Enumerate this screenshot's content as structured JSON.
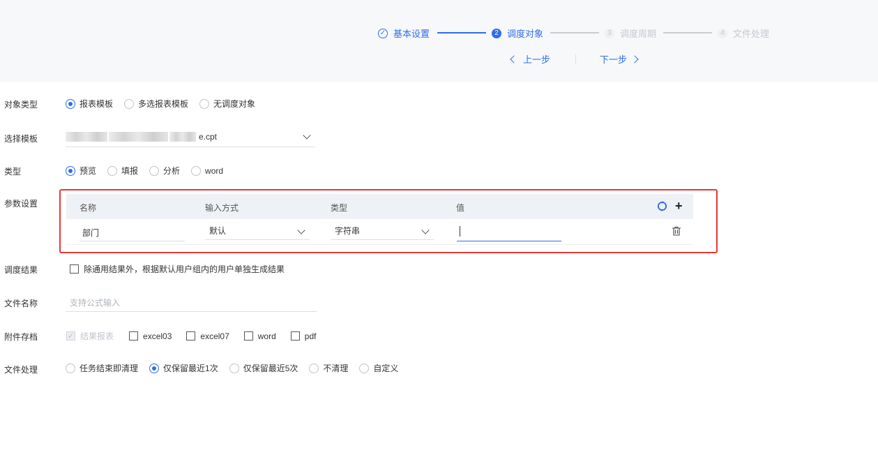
{
  "steps": [
    {
      "num": "✓",
      "label": "基本设置",
      "state": "done"
    },
    {
      "num": "2",
      "label": "调度对象",
      "state": "active"
    },
    {
      "num": "3",
      "label": "调度周期",
      "state": "todo"
    },
    {
      "num": "4",
      "label": "文件处理",
      "state": "todo"
    }
  ],
  "nav": {
    "prev": "上一步",
    "next": "下一步"
  },
  "object_type": {
    "label": "对象类型",
    "options": [
      "报表模板",
      "多选报表模板",
      "无调度对象"
    ],
    "selected": "报表模板"
  },
  "template": {
    "label": "选择模板",
    "value_suffix": "e.cpt"
  },
  "type": {
    "label": "类型",
    "options": [
      "预览",
      "填报",
      "分析",
      "word"
    ],
    "selected": "预览"
  },
  "params": {
    "label": "参数设置",
    "columns": [
      "名称",
      "输入方式",
      "类型",
      "值"
    ],
    "rows": [
      {
        "name": "部门",
        "input_mode": "默认",
        "data_type": "字符串",
        "value": ""
      }
    ]
  },
  "schedule_result": {
    "label": "调度结果",
    "checkbox": "除通用结果外，根据默认用户组内的用户单独生成结果"
  },
  "file_name": {
    "label": "文件名称",
    "placeholder": "支持公式输入"
  },
  "attachments": {
    "label": "附件存档",
    "options": [
      "结果报表",
      "excel03",
      "excel07",
      "word",
      "pdf"
    ]
  },
  "file_processing": {
    "label": "文件处理",
    "options": [
      "任务结束即清理",
      "仅保留最近1次",
      "仅保留最近5次",
      "不清理",
      "自定义"
    ],
    "selected": "仅保留最近1次"
  },
  "colors": {
    "accent": "#2f6ee8",
    "highlight": "#e53935"
  }
}
